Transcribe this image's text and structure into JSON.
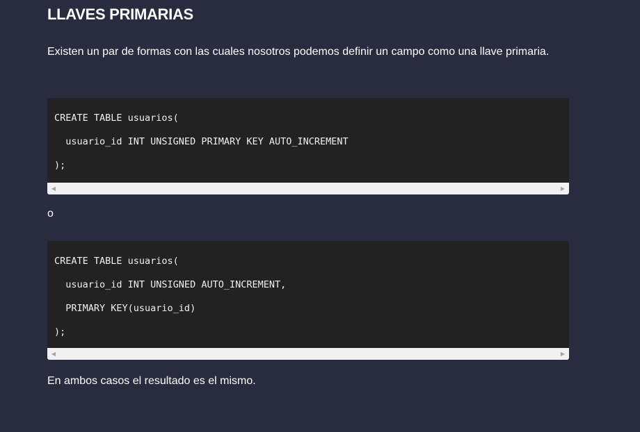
{
  "heading": "LLAVES PRIMARIAS",
  "intro_text": "Existen un par de formas con las cuales nosotros podemos definir un campo como una llave primaria.",
  "code_block_1": {
    "lines": [
      "CREATE TABLE usuarios(",
      "  usuario_id INT UNSIGNED PRIMARY KEY AUTO_INCREMENT",
      ");"
    ]
  },
  "separator_text": "o",
  "code_block_2": {
    "lines": [
      "CREATE TABLE usuarios(",
      "  usuario_id INT UNSIGNED AUTO_INCREMENT,",
      "  PRIMARY KEY(usuario_id)",
      ");"
    ]
  },
  "conclusion_text": "En ambos casos el resultado es el mismo.",
  "scrollbar": {
    "left_arrow": "◀",
    "right_arrow": "▶"
  }
}
